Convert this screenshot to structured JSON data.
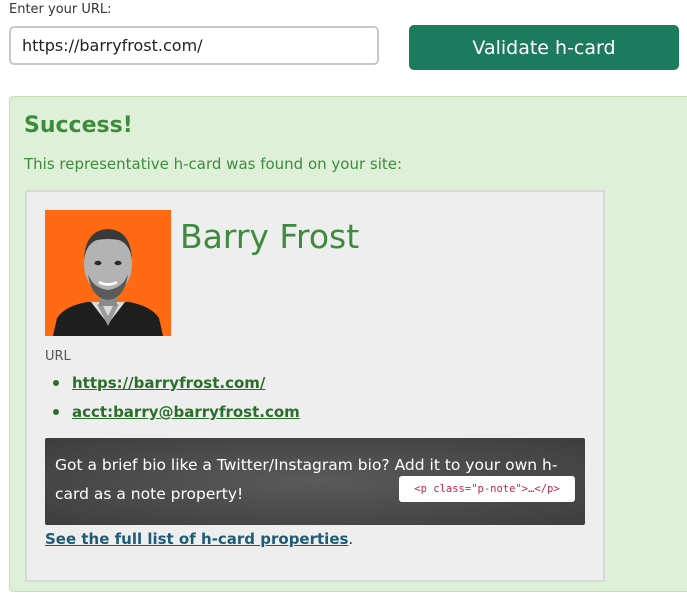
{
  "form": {
    "url_label": "Enter your URL:",
    "url_value": "https://barryfrost.com/",
    "submit_label": "Validate h-card"
  },
  "result": {
    "heading": "Success!",
    "message": "This representative h-card was found on your site:",
    "card": {
      "name": "Barry Frost",
      "avatar_background": "#ff6a13",
      "url_label": "URL",
      "urls": [
        "https://barryfrost.com/",
        "acct:barry@barryfrost.com"
      ],
      "tip": {
        "text": "Got a brief bio like a Twitter/Instagram bio? Add it to your own h-card as a note property!",
        "code": "<p class=\"p-note\">…</p>"
      },
      "full_list_link": "See the full list of h-card properties",
      "full_list_suffix": "."
    }
  },
  "colors": {
    "button": "#1c7a5d",
    "success_bg": "#dff0d8",
    "success_text": "#3d8b3d",
    "link": "#2b6e2b",
    "full_list_link": "#1d5c74"
  }
}
